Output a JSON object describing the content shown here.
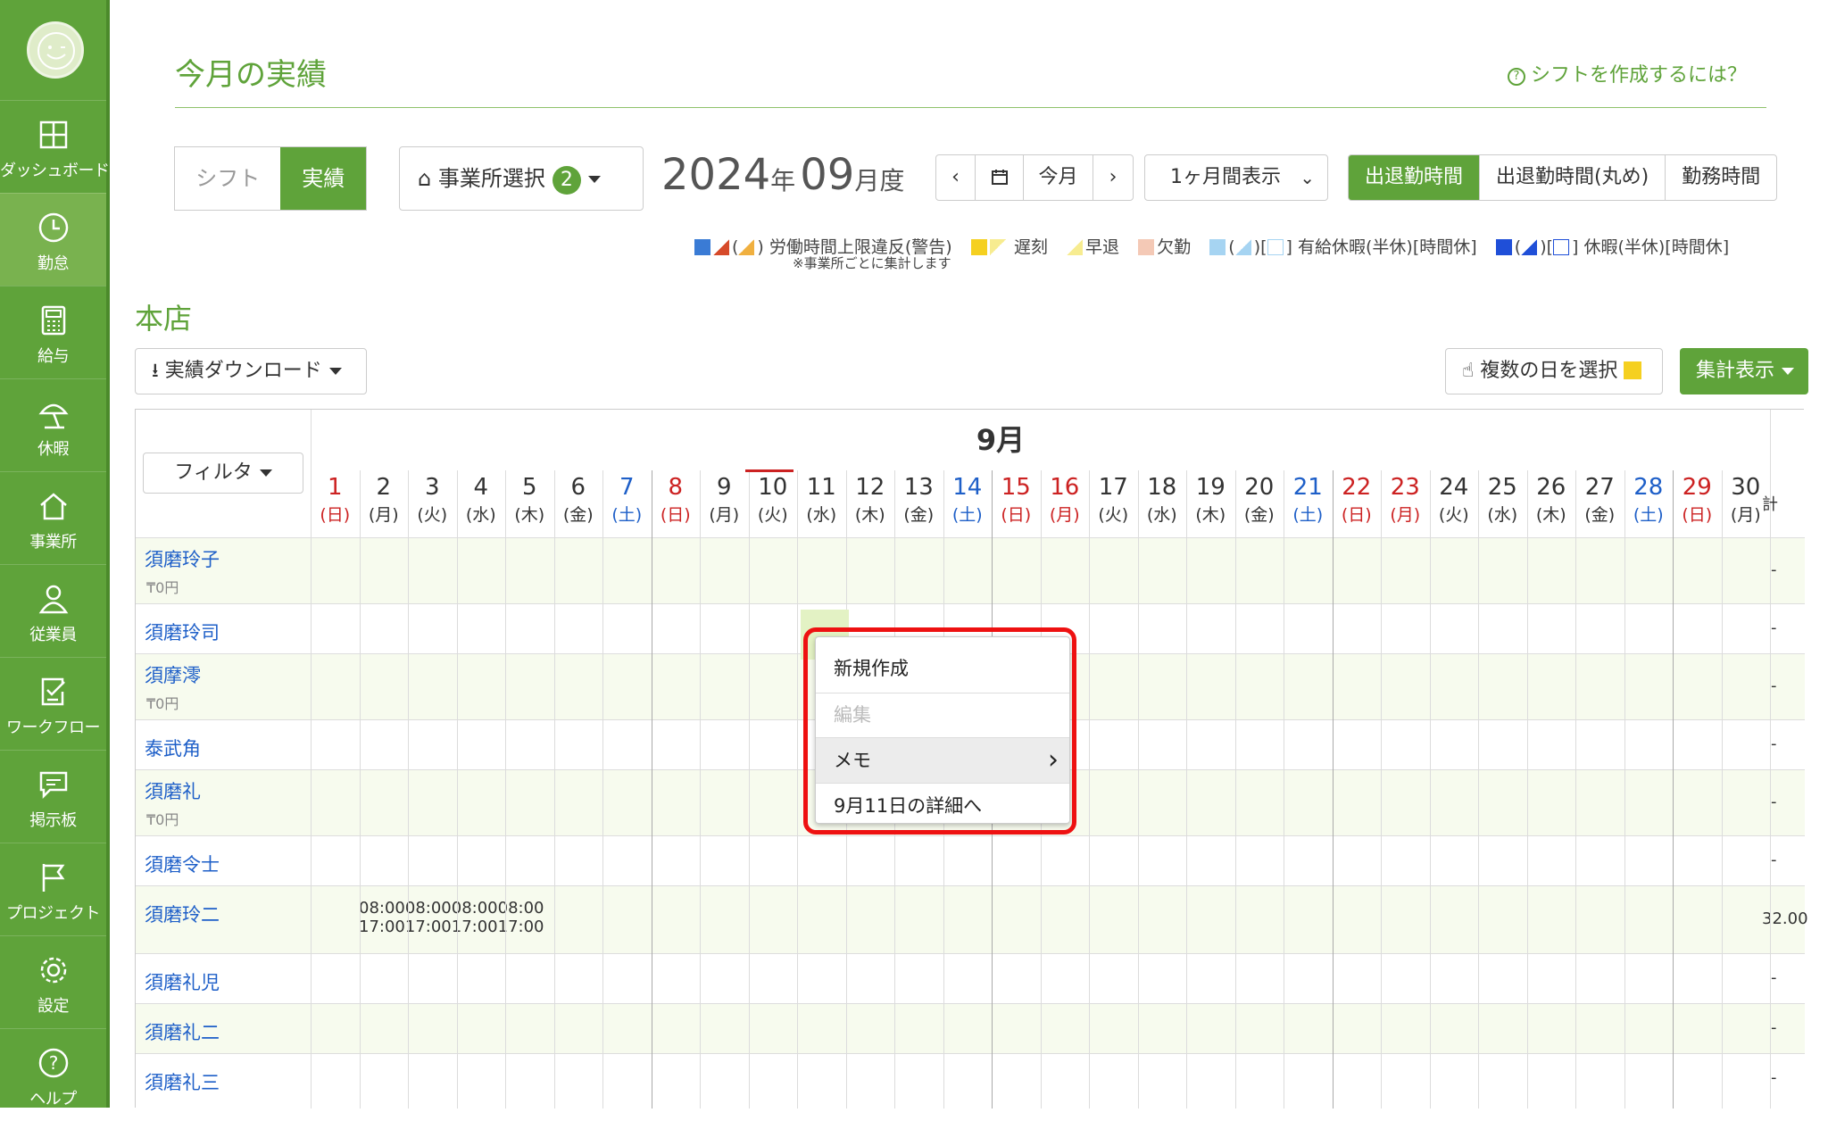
{
  "sidebar": {
    "items": [
      {
        "label": "ダッシュボード",
        "icon": "dashboard-icon"
      },
      {
        "label": "勤怠",
        "icon": "clock-icon"
      },
      {
        "label": "給与",
        "icon": "calculator-icon"
      },
      {
        "label": "休暇",
        "icon": "beach-umbrella-icon"
      },
      {
        "label": "事業所",
        "icon": "home-icon"
      },
      {
        "label": "従業員",
        "icon": "person-icon"
      },
      {
        "label": "ワークフロー",
        "icon": "checklist-icon"
      },
      {
        "label": "掲示板",
        "icon": "chat-bubble-icon"
      },
      {
        "label": "プロジェクト",
        "icon": "flag-icon"
      },
      {
        "label": "設定",
        "icon": "gear-icon"
      },
      {
        "label": "ヘルプ",
        "icon": "help-icon"
      }
    ]
  },
  "header": {
    "title": "今月の実績",
    "help_link": "シフトを作成するには？"
  },
  "toolbar": {
    "shift_tab": "シフト",
    "actual_tab": "実績",
    "office_select": "事業所選択",
    "office_count": "2",
    "year": "2024",
    "year_unit": "年",
    "month": "09",
    "month_unit": "月度",
    "prev": "‹",
    "this_month": "今月",
    "next": "›",
    "period": "1ヶ月間表示",
    "modes": [
      "出退勤時間",
      "出退勤時間(丸め)",
      "勤務時間"
    ]
  },
  "legend": {
    "labor_limit": "労働時間上限違反(警告)",
    "labor_note": "※事業所ごとに集計します",
    "late": "遅刻",
    "early_leave": "早退",
    "absence": "欠勤",
    "paid_leave": "有給休暇(半休)[時間休]",
    "leave": "休暇(半休)[時間休]"
  },
  "section": {
    "title": "本店",
    "download": "実績ダウンロード",
    "multi_select": "複数の日を選択",
    "summary": "集計表示"
  },
  "grid": {
    "month_label": "9月",
    "filter": "フィルタ",
    "total_label": "計",
    "days": [
      {
        "n": "1",
        "w": "(日)",
        "t": "sun"
      },
      {
        "n": "2",
        "w": "(月)",
        "t": "wk"
      },
      {
        "n": "3",
        "w": "(火)",
        "t": "wk"
      },
      {
        "n": "4",
        "w": "(水)",
        "t": "wk"
      },
      {
        "n": "5",
        "w": "(木)",
        "t": "wk"
      },
      {
        "n": "6",
        "w": "(金)",
        "t": "wk"
      },
      {
        "n": "7",
        "w": "(土)",
        "t": "sat"
      },
      {
        "n": "8",
        "w": "(日)",
        "t": "sun"
      },
      {
        "n": "9",
        "w": "(月)",
        "t": "wk"
      },
      {
        "n": "10",
        "w": "(火)",
        "t": "wk"
      },
      {
        "n": "11",
        "w": "(水)",
        "t": "wk"
      },
      {
        "n": "12",
        "w": "(木)",
        "t": "wk"
      },
      {
        "n": "13",
        "w": "(金)",
        "t": "wk"
      },
      {
        "n": "14",
        "w": "(土)",
        "t": "sat"
      },
      {
        "n": "15",
        "w": "(日)",
        "t": "sun"
      },
      {
        "n": "16",
        "w": "(月)",
        "t": "sun"
      },
      {
        "n": "17",
        "w": "(火)",
        "t": "wk"
      },
      {
        "n": "18",
        "w": "(水)",
        "t": "wk"
      },
      {
        "n": "19",
        "w": "(木)",
        "t": "wk"
      },
      {
        "n": "20",
        "w": "(金)",
        "t": "wk"
      },
      {
        "n": "21",
        "w": "(土)",
        "t": "sat"
      },
      {
        "n": "22",
        "w": "(日)",
        "t": "sun"
      },
      {
        "n": "23",
        "w": "(月)",
        "t": "sun"
      },
      {
        "n": "24",
        "w": "(火)",
        "t": "wk"
      },
      {
        "n": "25",
        "w": "(水)",
        "t": "wk"
      },
      {
        "n": "26",
        "w": "(木)",
        "t": "wk"
      },
      {
        "n": "27",
        "w": "(金)",
        "t": "wk"
      },
      {
        "n": "28",
        "w": "(土)",
        "t": "sat"
      },
      {
        "n": "29",
        "w": "(日)",
        "t": "sun"
      },
      {
        "n": "30",
        "w": "(月)",
        "t": "wk"
      }
    ],
    "employees": [
      {
        "name": "須磨玲子",
        "salary": "₸0円",
        "total": "-"
      },
      {
        "name": "須磨玲司",
        "salary": "",
        "total": "-"
      },
      {
        "name": "須摩澪",
        "salary": "₸0円",
        "total": "-"
      },
      {
        "name": "泰武角",
        "salary": "",
        "total": "-"
      },
      {
        "name": "須磨礼",
        "salary": "₸0円",
        "total": "-"
      },
      {
        "name": "須磨令士",
        "salary": "",
        "total": "-"
      },
      {
        "name": "須磨玲二",
        "salary": "",
        "total": "32.00",
        "times_in": "08:0008:0008:0008:00",
        "times_out": "17:0017:0017:0017:00"
      },
      {
        "name": "須磨礼児",
        "salary": "",
        "total": "-"
      },
      {
        "name": "須磨礼二",
        "salary": "",
        "total": "-"
      },
      {
        "name": "須磨礼三",
        "salary": "",
        "total": "-"
      }
    ]
  },
  "context_menu": {
    "items": [
      "新規作成",
      "編集",
      "メモ",
      "9月11日の詳細へ"
    ],
    "submenu_arrow": "›"
  },
  "colors": {
    "brand_green": "#5fa33a",
    "sunday_red": "#cc2222",
    "saturday_blue": "#1e5fc8",
    "highlight_red": "#ee1111"
  }
}
